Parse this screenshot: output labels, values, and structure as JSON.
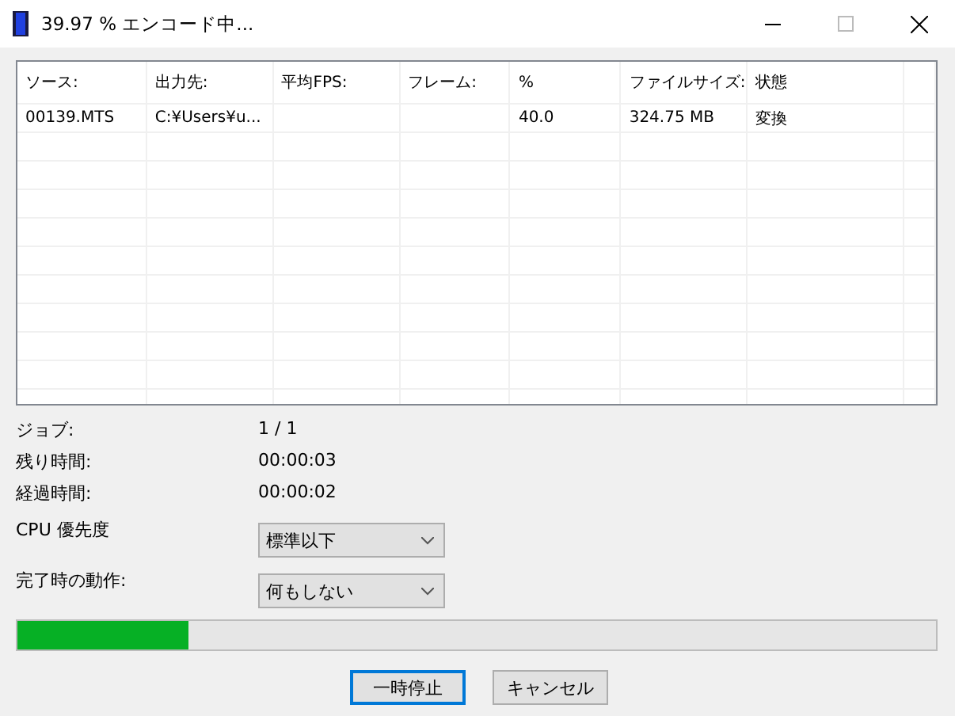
{
  "window": {
    "title": "39.97 % エンコード中..."
  },
  "table": {
    "columns": [
      "ソース:",
      "出力先:",
      "平均FPS:",
      "フレーム:",
      "%",
      "ファイルサイズ:",
      "状態"
    ],
    "rows": [
      [
        "00139.MTS",
        "C:¥Users¥u...",
        "",
        "",
        "40.0",
        "324.75 MB",
        "変換"
      ]
    ]
  },
  "info": [
    {
      "label": "ジョブ:",
      "value": "1 / 1"
    },
    {
      "label": "残り時間:",
      "value": "00:00:03"
    },
    {
      "label": "経過時間:",
      "value": "00:00:02"
    }
  ],
  "options": [
    {
      "label": "CPU 優先度",
      "value": "標準以下"
    },
    {
      "label": "完了時の動作:",
      "value": "何もしない"
    }
  ],
  "progress": {
    "level": 0.186
  },
  "buttons": [
    {
      "label": "一時停止",
      "focused": true
    },
    {
      "label": "キャンセル",
      "focused": false
    }
  ]
}
